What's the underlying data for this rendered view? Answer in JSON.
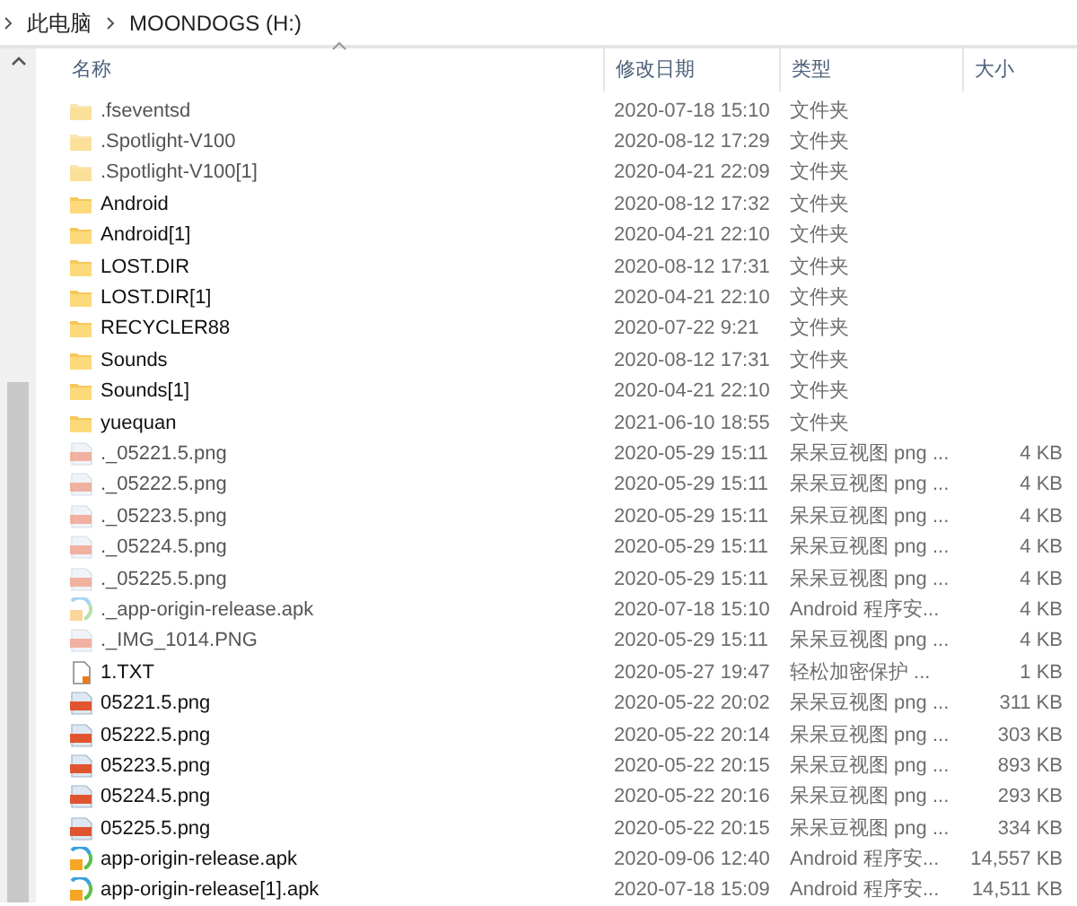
{
  "breadcrumb": [
    "此电脑",
    "MOONDOGS (H:)"
  ],
  "columns": [
    {
      "label": "名称",
      "sorted": true
    },
    {
      "label": "修改日期",
      "sorted": false
    },
    {
      "label": "类型",
      "sorted": false
    },
    {
      "label": "大小",
      "sorted": false
    }
  ],
  "rows": [
    {
      "kind": "folder",
      "hidden": true,
      "name": ".fseventsd",
      "date": "2020-07-18 15:10",
      "type": "文件夹"
    },
    {
      "kind": "folder",
      "hidden": true,
      "name": ".Spotlight-V100",
      "date": "2020-08-12 17:29",
      "type": "文件夹"
    },
    {
      "kind": "folder",
      "hidden": true,
      "name": ".Spotlight-V100[1]",
      "date": "2020-04-21 22:09",
      "type": "文件夹"
    },
    {
      "kind": "folder",
      "hidden": false,
      "name": "Android",
      "date": "2020-08-12 17:32",
      "type": "文件夹"
    },
    {
      "kind": "folder",
      "hidden": false,
      "name": "Android[1]",
      "date": "2020-04-21 22:10",
      "type": "文件夹"
    },
    {
      "kind": "folder",
      "hidden": false,
      "name": "LOST.DIR",
      "date": "2020-08-12 17:31",
      "type": "文件夹"
    },
    {
      "kind": "folder",
      "hidden": false,
      "name": "LOST.DIR[1]",
      "date": "2020-04-21 22:10",
      "type": "文件夹"
    },
    {
      "kind": "folder",
      "hidden": false,
      "name": "RECYCLER88",
      "date": "2020-07-22 9:21",
      "type": "文件夹"
    },
    {
      "kind": "folder",
      "hidden": false,
      "name": "Sounds",
      "date": "2020-08-12 17:31",
      "type": "文件夹"
    },
    {
      "kind": "folder",
      "hidden": false,
      "name": "Sounds[1]",
      "date": "2020-04-21 22:10",
      "type": "文件夹"
    },
    {
      "kind": "folder",
      "hidden": false,
      "name": "yuequan",
      "date": "2021-06-10 18:55",
      "type": "文件夹"
    },
    {
      "kind": "image",
      "hidden": true,
      "name": "._05221.5.png",
      "date": "2020-05-29 15:11",
      "type": "呆呆豆视图 png ...",
      "size": "4 KB"
    },
    {
      "kind": "image",
      "hidden": true,
      "name": "._05222.5.png",
      "date": "2020-05-29 15:11",
      "type": "呆呆豆视图 png ...",
      "size": "4 KB"
    },
    {
      "kind": "image",
      "hidden": true,
      "name": "._05223.5.png",
      "date": "2020-05-29 15:11",
      "type": "呆呆豆视图 png ...",
      "size": "4 KB"
    },
    {
      "kind": "image",
      "hidden": true,
      "name": "._05224.5.png",
      "date": "2020-05-29 15:11",
      "type": "呆呆豆视图 png ...",
      "size": "4 KB"
    },
    {
      "kind": "image",
      "hidden": true,
      "name": "._05225.5.png",
      "date": "2020-05-29 15:11",
      "type": "呆呆豆视图 png ...",
      "size": "4 KB"
    },
    {
      "kind": "apk",
      "hidden": true,
      "name": "._app-origin-release.apk",
      "date": "2020-07-18 15:10",
      "type": "Android 程序安...",
      "size": "4 KB"
    },
    {
      "kind": "image",
      "hidden": true,
      "name": "._IMG_1014.PNG",
      "date": "2020-05-29 15:11",
      "type": "呆呆豆视图 png ...",
      "size": "4 KB"
    },
    {
      "kind": "text",
      "hidden": false,
      "name": "1.TXT",
      "date": "2020-05-27 19:47",
      "type": "轻松加密保护 ...",
      "size": "1 KB"
    },
    {
      "kind": "image",
      "hidden": false,
      "name": "05221.5.png",
      "date": "2020-05-22 20:02",
      "type": "呆呆豆视图 png ...",
      "size": "311 KB"
    },
    {
      "kind": "image",
      "hidden": false,
      "name": "05222.5.png",
      "date": "2020-05-22 20:14",
      "type": "呆呆豆视图 png ...",
      "size": "303 KB"
    },
    {
      "kind": "image",
      "hidden": false,
      "name": "05223.5.png",
      "date": "2020-05-22 20:15",
      "type": "呆呆豆视图 png ...",
      "size": "893 KB"
    },
    {
      "kind": "image",
      "hidden": false,
      "name": "05224.5.png",
      "date": "2020-05-22 20:16",
      "type": "呆呆豆视图 png ...",
      "size": "293 KB"
    },
    {
      "kind": "image",
      "hidden": false,
      "name": "05225.5.png",
      "date": "2020-05-22 20:15",
      "type": "呆呆豆视图 png ...",
      "size": "334 KB"
    },
    {
      "kind": "apk",
      "hidden": false,
      "name": "app-origin-release.apk",
      "date": "2020-09-06 12:40",
      "type": "Android 程序安...",
      "size": "14,557 KB"
    },
    {
      "kind": "apk",
      "hidden": false,
      "name": "app-origin-release[1].apk",
      "date": "2020-07-18 15:09",
      "type": "Android 程序安...",
      "size": "14,511 KB"
    }
  ]
}
